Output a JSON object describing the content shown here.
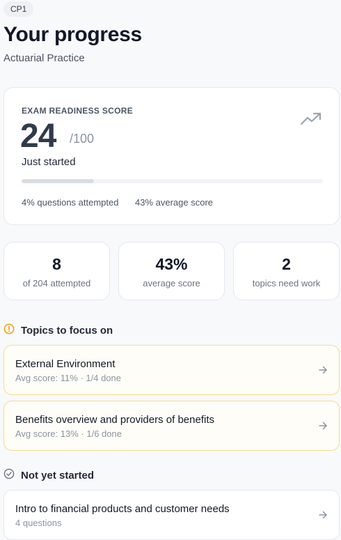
{
  "header": {
    "badge": "CP1",
    "title": "Your progress",
    "subtitle": "Actuarial Practice"
  },
  "readiness": {
    "label": "EXAM READINESS SCORE",
    "score": "24",
    "out_of": "/100",
    "status": "Just started",
    "progress_fraction": 0.24,
    "stats": {
      "attempted": "4% questions attempted",
      "average": "43% average score"
    },
    "icon": "trending-up-icon"
  },
  "stats": [
    {
      "value": "8",
      "caption": "of 204 attempted"
    },
    {
      "value": "43%",
      "caption": "average score"
    },
    {
      "value": "2",
      "caption": "topics need work"
    }
  ],
  "focus": {
    "heading": "Topics to focus on",
    "icon": "alert-circle-icon",
    "accent": "#f59e0b",
    "items": [
      {
        "name": "External Environment",
        "meta": "Avg score: 11% · 1/4 done"
      },
      {
        "name": "Benefits overview and providers of benefits",
        "meta": "Avg score: 13% · 1/6 done"
      }
    ]
  },
  "not_started": {
    "heading": "Not yet started",
    "icon": "check-circle-icon",
    "items": [
      {
        "name": "Intro to financial products and customer needs",
        "meta": "4 questions"
      }
    ]
  }
}
